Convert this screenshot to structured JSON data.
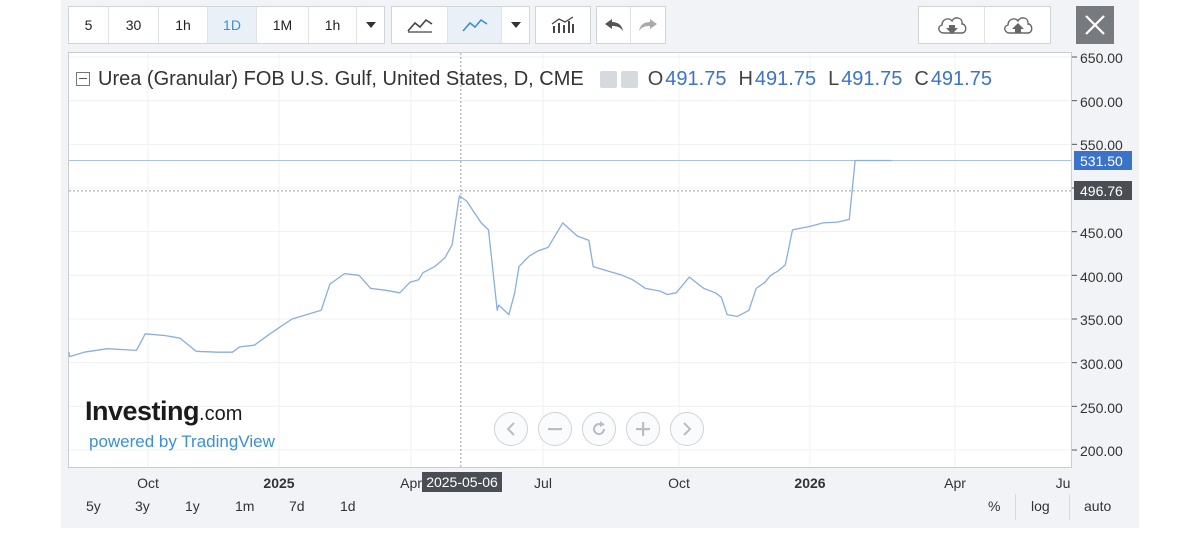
{
  "toolbar": {
    "intervals": [
      "5",
      "30",
      "1h",
      "1D",
      "1M"
    ],
    "active_interval": "1D",
    "interval_dropdown": "1h",
    "icons": [
      "area-chart-icon",
      "line-chart-icon",
      "chart-type-dropdown-icon",
      "indicators-icon",
      "undo-icon",
      "redo-icon",
      "cloud-download-icon",
      "cloud-upload-icon",
      "close-icon"
    ]
  },
  "legend": {
    "title": "Urea (Granular) FOB U.S. Gulf, United States, D, CME",
    "o_label": "O",
    "o_value": "491.75",
    "h_label": "H",
    "h_value": "491.75",
    "l_label": "L",
    "l_value": "491.75",
    "c_label": "C",
    "c_value": "491.75"
  },
  "branding": {
    "logo_main": "Investing",
    "logo_suffix": ".com",
    "powered": "powered by TradingView"
  },
  "nav": [
    "chevron-left-icon",
    "zoom-out-icon",
    "reset-icon",
    "zoom-in-icon",
    "chevron-right-icon"
  ],
  "bottom": {
    "ranges": [
      "5y",
      "3y",
      "1y",
      "1m",
      "7d",
      "1d"
    ],
    "options": [
      "%",
      "log",
      "auto"
    ]
  },
  "colors": {
    "line": "#8aaee0",
    "last_tag": "#3a73c8",
    "cross_tag": "#4a4e54",
    "accent": "#3a8fd8"
  },
  "chart_data": {
    "type": "line",
    "title": "Urea (Granular) FOB U.S. Gulf, United States, D, CME",
    "y_ticks": [
      "650.00",
      "600.00",
      "550.00",
      "450.00",
      "400.00",
      "350.00",
      "300.00",
      "250.00",
      "200.00"
    ],
    "x_ticks": [
      "Oct",
      "2025",
      "Apr",
      "Jul",
      "Oct",
      "2026",
      "Apr",
      "Ju"
    ],
    "bold_x_ticks": [
      "2025",
      "2026"
    ],
    "ylim": [
      200,
      650
    ],
    "last_price": "531.50",
    "crosshair_price": "496.76",
    "crosshair_date": "2025-05-06",
    "series": [
      {
        "x": [
          "2024-07-26",
          "2024-08-10",
          "2024-08-20",
          "2024-09-05",
          "2024-09-25",
          "2024-10-01",
          "2024-10-15",
          "2024-10-25",
          "2024-11-05",
          "2024-11-20",
          "2024-11-30",
          "2024-12-05",
          "2024-12-15",
          "2024-12-25",
          "2025-01-01",
          "2025-01-10",
          "2025-01-20",
          "2025-01-30",
          "2025-02-05",
          "2025-02-15",
          "2025-02-25",
          "2025-03-05",
          "2025-03-15",
          "2025-03-25",
          "2025-04-01",
          "2025-04-07",
          "2025-04-10",
          "2025-04-18",
          "2025-04-25",
          "2025-04-30",
          "2025-05-05",
          "2025-05-10",
          "2025-05-20",
          "2025-05-25",
          "2025-05-31",
          "2025-06-01",
          "2025-06-08",
          "2025-06-12",
          "2025-06-15",
          "2025-06-22",
          "2025-06-28",
          "2025-07-05",
          "2025-07-15",
          "2025-07-25",
          "2025-08-02",
          "2025-08-05",
          "2025-08-15",
          "2025-08-25",
          "2025-09-01",
          "2025-09-10",
          "2025-09-20",
          "2025-09-25",
          "2025-10-01",
          "2025-10-10",
          "2025-10-20",
          "2025-10-28",
          "2025-11-01",
          "2025-11-05",
          "2025-11-12",
          "2025-11-20",
          "2025-11-25",
          "2025-12-01",
          "2025-12-05",
          "2025-12-10",
          "2025-12-15",
          "2025-12-20",
          "2026-01-01",
          "2026-01-10",
          "2026-01-20",
          "2026-01-28",
          "2026-02-01",
          "2026-02-10",
          "2026-02-20",
          "2026-02-24",
          "2026-02-26"
        ],
        "values": [
          312,
          307,
          312,
          316,
          314,
          333,
          331,
          328,
          313,
          312,
          312,
          318,
          320,
          332,
          340,
          350,
          355,
          360,
          390,
          402,
          400,
          385,
          383,
          380,
          392,
          395,
          403,
          410,
          420,
          435,
          491,
          485,
          460,
          452,
          360,
          366,
          355,
          380,
          410,
          422,
          428,
          432,
          460,
          445,
          440,
          410,
          405,
          400,
          395,
          385,
          382,
          378,
          380,
          398,
          385,
          380,
          375,
          355,
          353,
          360,
          385,
          392,
          400,
          405,
          412,
          452,
          456,
          460,
          461,
          464,
          531.5,
          531.5,
          531.5,
          531.5,
          531.5
        ]
      }
    ],
    "grid": true,
    "legend_position": "top-left"
  }
}
